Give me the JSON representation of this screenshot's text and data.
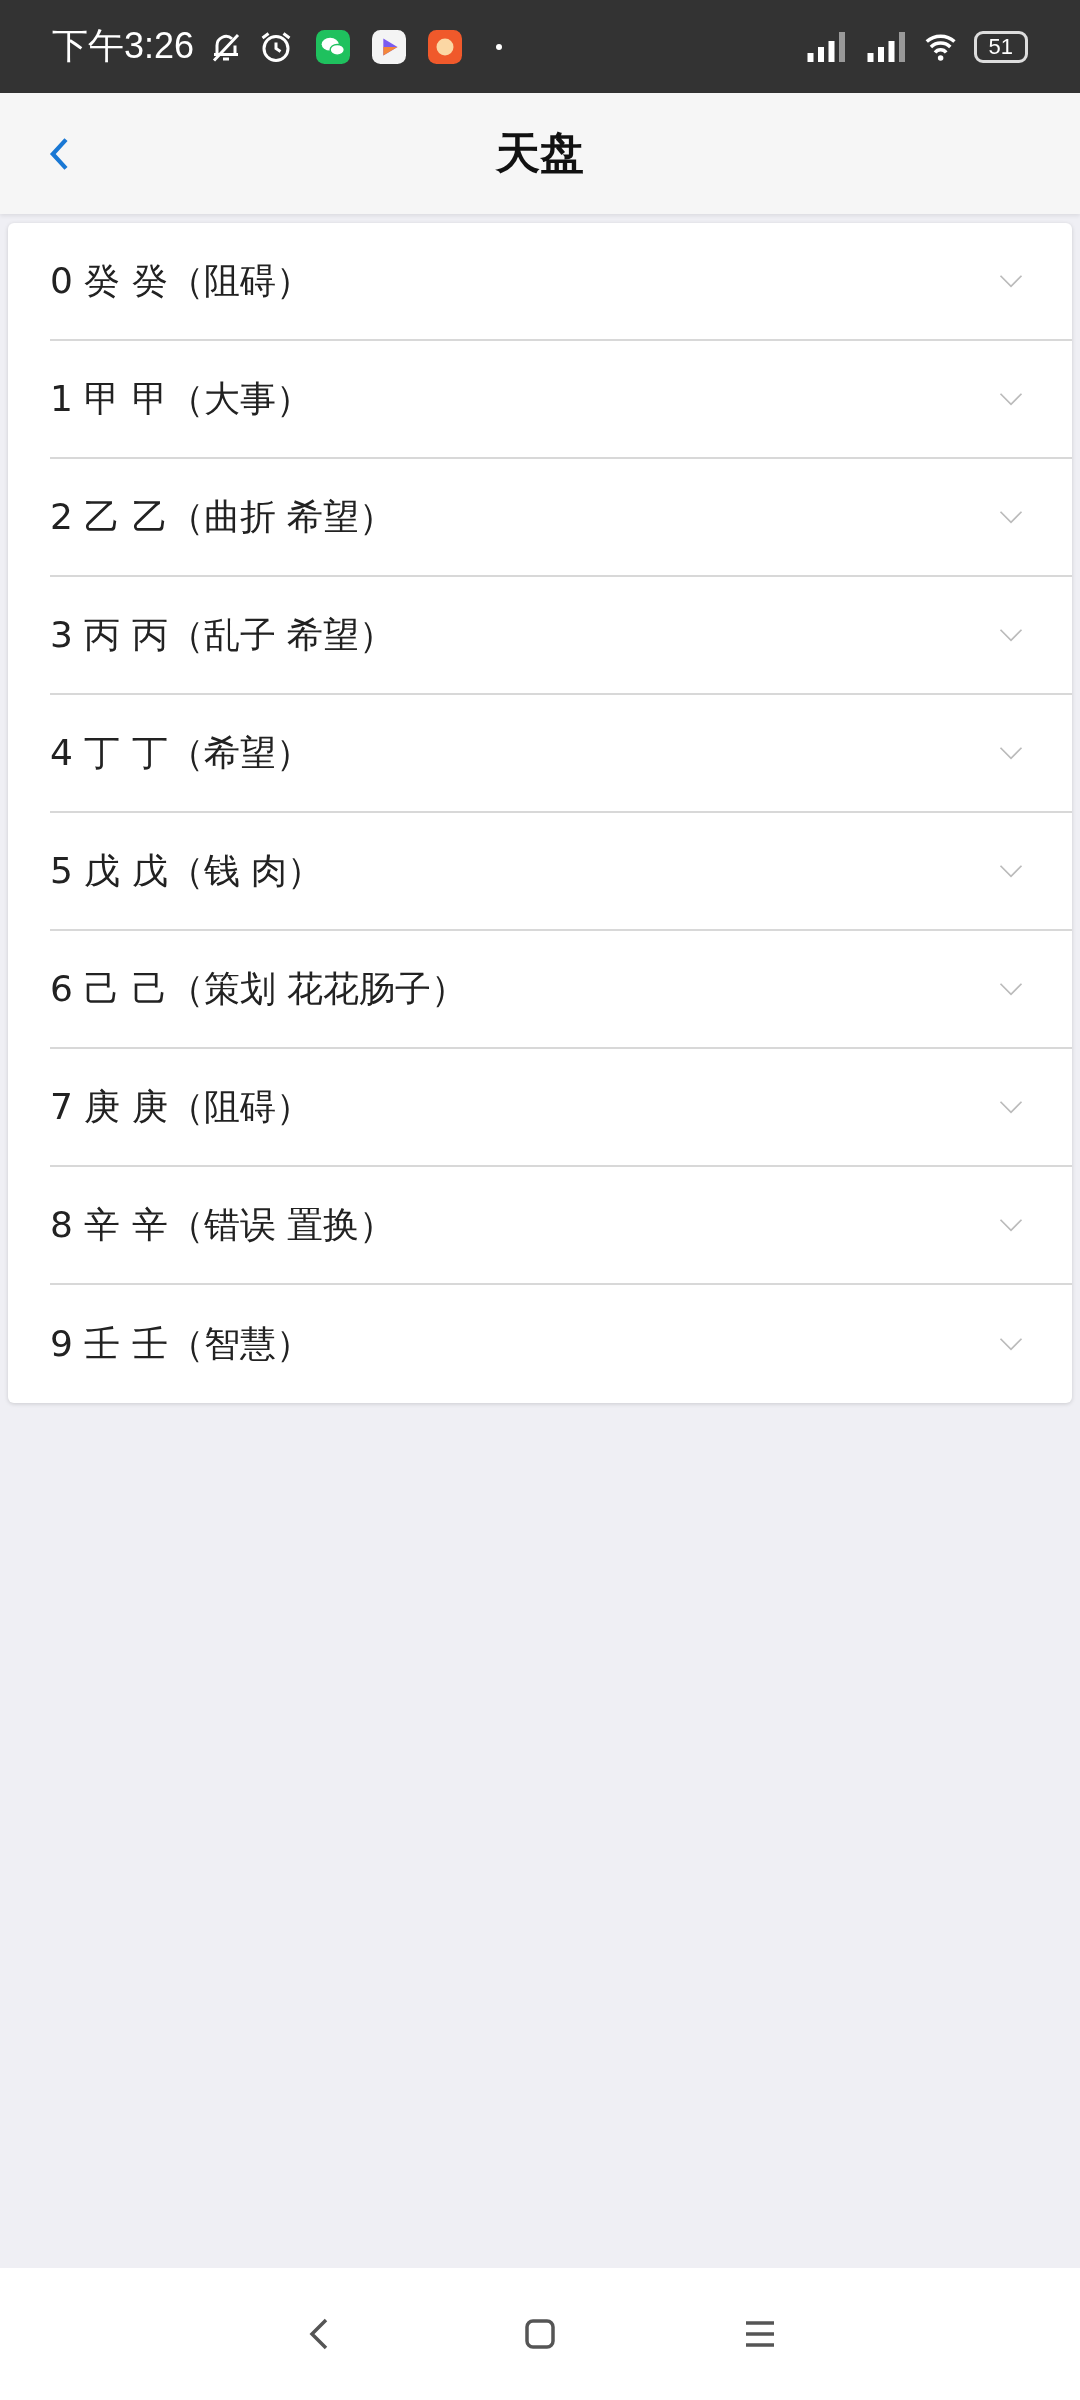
{
  "status_bar": {
    "time": "下午3:26",
    "battery": "51"
  },
  "header": {
    "title": "天盘"
  },
  "items": [
    {
      "label": "0 癸 癸（阻碍）",
      "expanded": false
    },
    {
      "label": "1 甲 甲（大事）",
      "expanded": false
    },
    {
      "label": "2 乙 乙（曲折 希望）",
      "expanded": false
    },
    {
      "label": "3 丙 丙（乱子 希望）",
      "expanded": false
    },
    {
      "label": "4 丁 丁（希望）",
      "expanded": false
    },
    {
      "label": "5 戊 戊（钱 肉）",
      "expanded": false
    },
    {
      "label": "6 己 己（策划 花花肠子）",
      "expanded": false
    },
    {
      "label": "7 庚 庚（阻碍）",
      "expanded": false
    },
    {
      "label": "8 辛 辛（错误 置换）",
      "expanded": false
    },
    {
      "label": "9 壬 壬（智慧）",
      "expanded": false
    }
  ]
}
